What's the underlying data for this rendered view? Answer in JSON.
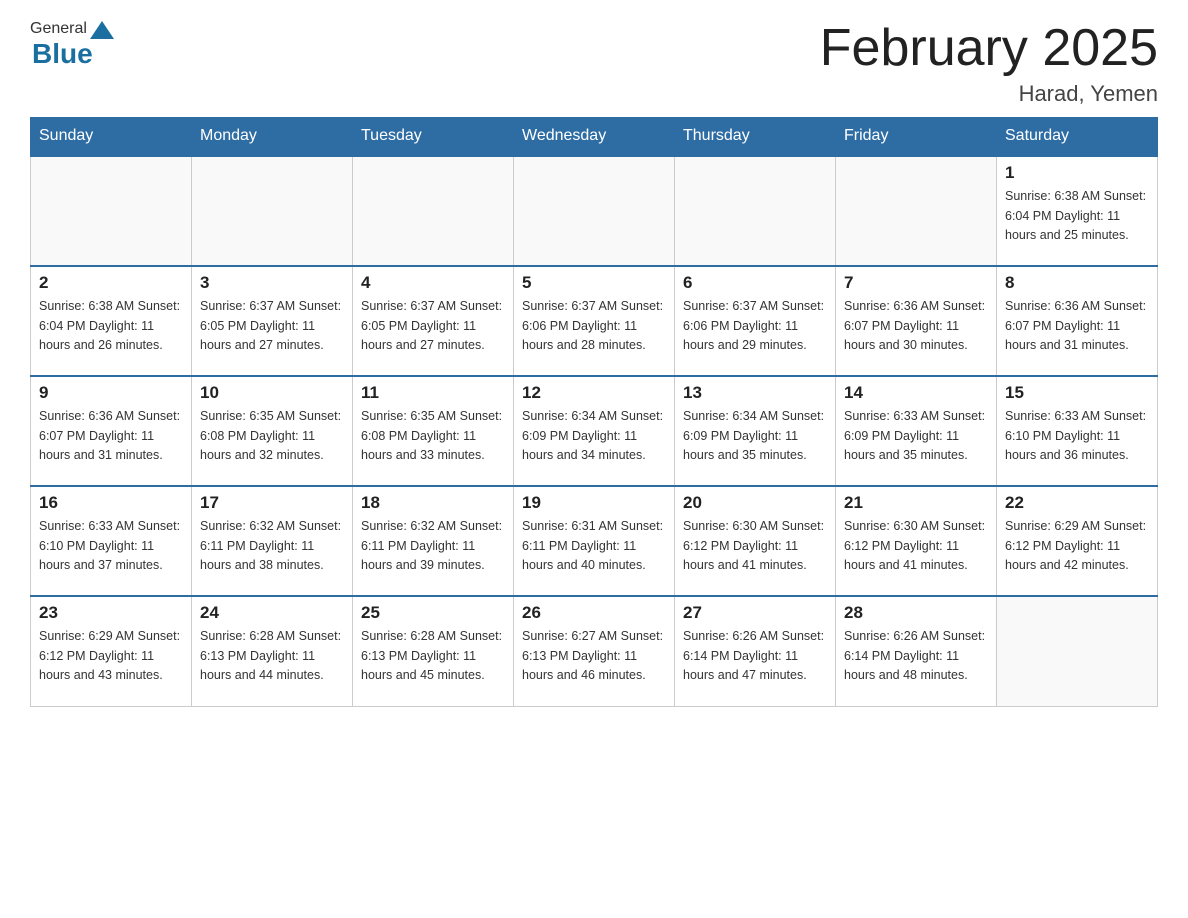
{
  "header": {
    "logo_general": "General",
    "logo_blue": "Blue",
    "month_title": "February 2025",
    "location": "Harad, Yemen"
  },
  "weekdays": [
    "Sunday",
    "Monday",
    "Tuesday",
    "Wednesday",
    "Thursday",
    "Friday",
    "Saturday"
  ],
  "weeks": [
    [
      {
        "day": "",
        "info": ""
      },
      {
        "day": "",
        "info": ""
      },
      {
        "day": "",
        "info": ""
      },
      {
        "day": "",
        "info": ""
      },
      {
        "day": "",
        "info": ""
      },
      {
        "day": "",
        "info": ""
      },
      {
        "day": "1",
        "info": "Sunrise: 6:38 AM\nSunset: 6:04 PM\nDaylight: 11 hours\nand 25 minutes."
      }
    ],
    [
      {
        "day": "2",
        "info": "Sunrise: 6:38 AM\nSunset: 6:04 PM\nDaylight: 11 hours\nand 26 minutes."
      },
      {
        "day": "3",
        "info": "Sunrise: 6:37 AM\nSunset: 6:05 PM\nDaylight: 11 hours\nand 27 minutes."
      },
      {
        "day": "4",
        "info": "Sunrise: 6:37 AM\nSunset: 6:05 PM\nDaylight: 11 hours\nand 27 minutes."
      },
      {
        "day": "5",
        "info": "Sunrise: 6:37 AM\nSunset: 6:06 PM\nDaylight: 11 hours\nand 28 minutes."
      },
      {
        "day": "6",
        "info": "Sunrise: 6:37 AM\nSunset: 6:06 PM\nDaylight: 11 hours\nand 29 minutes."
      },
      {
        "day": "7",
        "info": "Sunrise: 6:36 AM\nSunset: 6:07 PM\nDaylight: 11 hours\nand 30 minutes."
      },
      {
        "day": "8",
        "info": "Sunrise: 6:36 AM\nSunset: 6:07 PM\nDaylight: 11 hours\nand 31 minutes."
      }
    ],
    [
      {
        "day": "9",
        "info": "Sunrise: 6:36 AM\nSunset: 6:07 PM\nDaylight: 11 hours\nand 31 minutes."
      },
      {
        "day": "10",
        "info": "Sunrise: 6:35 AM\nSunset: 6:08 PM\nDaylight: 11 hours\nand 32 minutes."
      },
      {
        "day": "11",
        "info": "Sunrise: 6:35 AM\nSunset: 6:08 PM\nDaylight: 11 hours\nand 33 minutes."
      },
      {
        "day": "12",
        "info": "Sunrise: 6:34 AM\nSunset: 6:09 PM\nDaylight: 11 hours\nand 34 minutes."
      },
      {
        "day": "13",
        "info": "Sunrise: 6:34 AM\nSunset: 6:09 PM\nDaylight: 11 hours\nand 35 minutes."
      },
      {
        "day": "14",
        "info": "Sunrise: 6:33 AM\nSunset: 6:09 PM\nDaylight: 11 hours\nand 35 minutes."
      },
      {
        "day": "15",
        "info": "Sunrise: 6:33 AM\nSunset: 6:10 PM\nDaylight: 11 hours\nand 36 minutes."
      }
    ],
    [
      {
        "day": "16",
        "info": "Sunrise: 6:33 AM\nSunset: 6:10 PM\nDaylight: 11 hours\nand 37 minutes."
      },
      {
        "day": "17",
        "info": "Sunrise: 6:32 AM\nSunset: 6:11 PM\nDaylight: 11 hours\nand 38 minutes."
      },
      {
        "day": "18",
        "info": "Sunrise: 6:32 AM\nSunset: 6:11 PM\nDaylight: 11 hours\nand 39 minutes."
      },
      {
        "day": "19",
        "info": "Sunrise: 6:31 AM\nSunset: 6:11 PM\nDaylight: 11 hours\nand 40 minutes."
      },
      {
        "day": "20",
        "info": "Sunrise: 6:30 AM\nSunset: 6:12 PM\nDaylight: 11 hours\nand 41 minutes."
      },
      {
        "day": "21",
        "info": "Sunrise: 6:30 AM\nSunset: 6:12 PM\nDaylight: 11 hours\nand 41 minutes."
      },
      {
        "day": "22",
        "info": "Sunrise: 6:29 AM\nSunset: 6:12 PM\nDaylight: 11 hours\nand 42 minutes."
      }
    ],
    [
      {
        "day": "23",
        "info": "Sunrise: 6:29 AM\nSunset: 6:12 PM\nDaylight: 11 hours\nand 43 minutes."
      },
      {
        "day": "24",
        "info": "Sunrise: 6:28 AM\nSunset: 6:13 PM\nDaylight: 11 hours\nand 44 minutes."
      },
      {
        "day": "25",
        "info": "Sunrise: 6:28 AM\nSunset: 6:13 PM\nDaylight: 11 hours\nand 45 minutes."
      },
      {
        "day": "26",
        "info": "Sunrise: 6:27 AM\nSunset: 6:13 PM\nDaylight: 11 hours\nand 46 minutes."
      },
      {
        "day": "27",
        "info": "Sunrise: 6:26 AM\nSunset: 6:14 PM\nDaylight: 11 hours\nand 47 minutes."
      },
      {
        "day": "28",
        "info": "Sunrise: 6:26 AM\nSunset: 6:14 PM\nDaylight: 11 hours\nand 48 minutes."
      },
      {
        "day": "",
        "info": ""
      }
    ]
  ]
}
